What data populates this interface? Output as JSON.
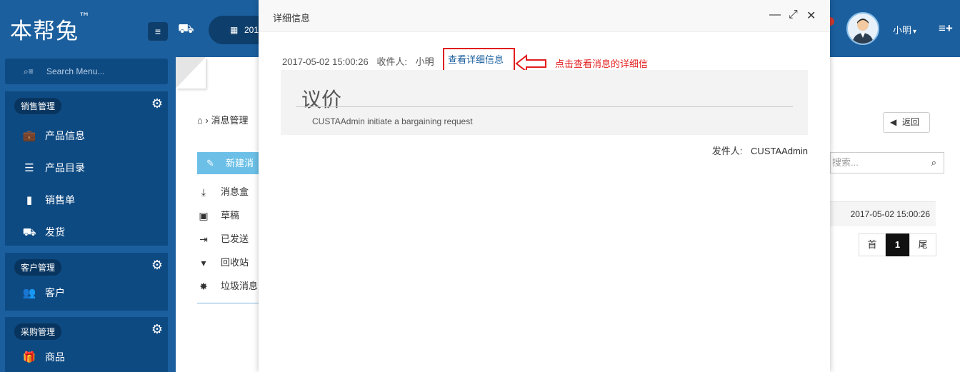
{
  "header": {
    "brand": "本帮兔",
    "brand_tm": "™",
    "menu_icon": "hamburger-icon",
    "pill_text": "201",
    "username": "小明",
    "username_caret": "▾",
    "plus_icon": "add-menu-icon"
  },
  "sidebar": {
    "search_placeholder": "Search Menu...",
    "sections": [
      {
        "title": "销售管理",
        "items": [
          {
            "label": "产品信息",
            "icon": "briefcase-icon"
          },
          {
            "label": "产品目录",
            "icon": "list-icon"
          },
          {
            "label": "销售单",
            "icon": "clipboard-icon"
          },
          {
            "label": "发货",
            "icon": "truck-icon"
          }
        ]
      },
      {
        "title": "客户管理",
        "items": [
          {
            "label": "客户",
            "icon": "users-icon"
          }
        ]
      },
      {
        "title": "采购管理",
        "items": [
          {
            "label": "商品",
            "icon": "gift-icon"
          }
        ]
      }
    ]
  },
  "main": {
    "breadcrumb": "消息管理",
    "back_label": "返回",
    "new_label": "新建消息",
    "folders": [
      "消息盒",
      "草稿",
      "已发送",
      "回收站",
      "垃圾消息"
    ],
    "search_placeholder": "搜索...",
    "row_date": "2017-05-02 15:00:26",
    "pager": {
      "first": "首",
      "current": "1",
      "last": "尾"
    }
  },
  "modal": {
    "title": "详细信息",
    "datetime": "2017-05-02 15:00:26",
    "recipient_label": "收件人:",
    "recipient": "小明",
    "detail_link": "查看详细信息",
    "message_title": "议价",
    "message_body": "CUSTAAdmin initiate a bargaining request",
    "sender_label": "发件人:",
    "sender": "CUSTAAdmin"
  },
  "annotation": {
    "text": "点击查看消息的详细信息",
    "color": "#e21d1d"
  },
  "colors": {
    "primary": "#1b5f9e",
    "sidebar_section": "#0e4a82",
    "new_button": "#6cc0e8"
  }
}
